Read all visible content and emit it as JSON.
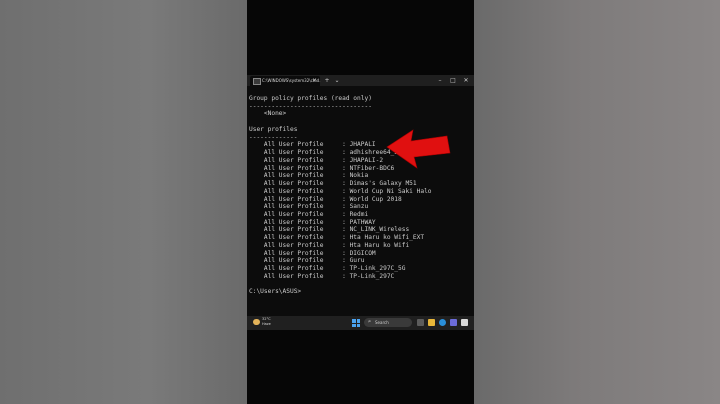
{
  "window": {
    "tab_title": "C:\\WINDOWS\\system32\\cmd.",
    "tab_close": "×",
    "new_tab": "+",
    "tab_dropdown": "⌄",
    "minimize": "–",
    "maximize": "□",
    "close": "✕"
  },
  "console": {
    "lines": [
      "Group policy profiles (read only)",
      "---------------------------------",
      "    <None>",
      "",
      "User profiles",
      "-------------",
      "    All User Profile     : JHAPALI",
      "    All User Profile     : adhishree64_5",
      "    All User Profile     : JHAPALI-2",
      "    All User Profile     : NTFiber-BDC6",
      "    All User Profile     : Nokia",
      "    All User Profile     : Dimas's Galaxy M51",
      "    All User Profile     : World Cup Ni Saki Halo",
      "    All User Profile     : World Cup 2018",
      "    All User Profile     : Sanzu",
      "    All User Profile     : Redmi",
      "    All User Profile     : PATHWAY",
      "    All User Profile     : NC_LINK_Wireless",
      "    All User Profile     : Hta Haru ko Wifi_EXT",
      "    All User Profile     : Hta Haru ko Wifi",
      "    All User Profile     : DIGICOM",
      "    All User Profile     : Guru",
      "    All User Profile     : TP-Link_297C_5G",
      "    All User Profile     : TP-Link_297C",
      "",
      "C:\\Users\\ASUS>"
    ]
  },
  "taskbar": {
    "weather_temp": "32°C",
    "weather_desc": "Haze",
    "search_placeholder": "Search"
  },
  "colors": {
    "console_text": "#cccccc",
    "console_bg": "#0c0c0c",
    "arrow": "#e01010"
  },
  "icons": [
    "cmd-icon",
    "weather-icon",
    "windows-start-icon",
    "search-icon",
    "task-view-icon",
    "file-explorer-icon",
    "edge-icon",
    "store-icon",
    "red-arrow-icon"
  ]
}
